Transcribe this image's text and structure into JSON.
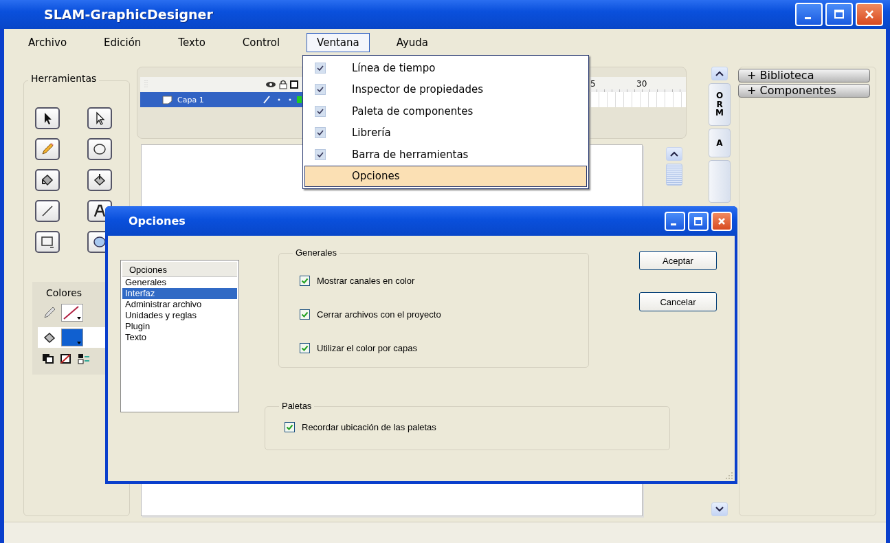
{
  "window": {
    "title": "SLAM-GraphicDesigner"
  },
  "menu_bar": [
    {
      "label": "Archivo",
      "selected": false
    },
    {
      "label": "Edición",
      "selected": false
    },
    {
      "label": "Texto",
      "selected": false
    },
    {
      "label": "Control",
      "selected": false
    },
    {
      "label": "Ventana",
      "selected": true
    },
    {
      "label": "Ayuda",
      "selected": false
    }
  ],
  "tools_panel": {
    "title": "Herramientas",
    "colors_title": "Colores"
  },
  "timeline": {
    "layers": [
      {
        "name": "Capa 1",
        "selected": true
      }
    ],
    "ruler_labels": [
      "5",
      "30"
    ]
  },
  "side_tabs": [
    {
      "label": "ORM"
    },
    {
      "label": "A"
    }
  ],
  "library_panel": {
    "buttons": [
      "+ Biblioteca",
      "+ Componentes"
    ]
  },
  "ventana_menu": [
    {
      "label": "Línea de tiempo",
      "checked": true,
      "selected": false
    },
    {
      "label": "Inspector de propiedades",
      "checked": true,
      "selected": false
    },
    {
      "label": "Paleta de componentes",
      "checked": true,
      "selected": false
    },
    {
      "label": "Librería",
      "checked": true,
      "selected": false
    },
    {
      "label": "Barra de herramientas",
      "checked": true,
      "selected": false
    },
    {
      "label": "Opciones",
      "checked": false,
      "selected": true
    }
  ],
  "dialog": {
    "title": "Opciones",
    "list": {
      "header": "Opciones",
      "items": [
        {
          "label": "Generales",
          "selected": false
        },
        {
          "label": "Interfaz",
          "selected": true
        },
        {
          "label": "Administrar archivo",
          "selected": false
        },
        {
          "label": "Unidades y reglas",
          "selected": false
        },
        {
          "label": "Plugin",
          "selected": false
        },
        {
          "label": "Texto",
          "selected": false
        }
      ]
    },
    "groups": [
      {
        "title": "Generales",
        "options": [
          {
            "label": "Mostrar canales en color",
            "checked": true
          },
          {
            "label": "Cerrar archivos con el proyecto",
            "checked": true
          },
          {
            "label": "Utilizar el color por capas",
            "checked": true
          }
        ]
      },
      {
        "title": "Paletas",
        "options": [
          {
            "label": "Recordar ubicación de las paletas",
            "checked": true
          }
        ]
      }
    ],
    "buttons": [
      "Aceptar",
      "Cancelar"
    ]
  }
}
